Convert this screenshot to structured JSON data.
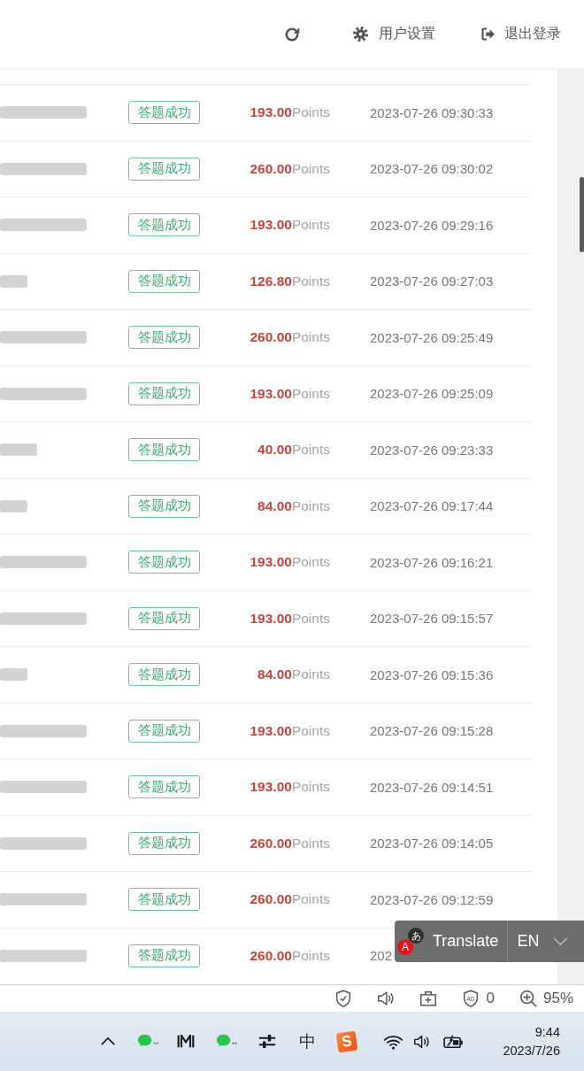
{
  "header": {
    "settings_label": "用户设置",
    "logout_label": "退出登录"
  },
  "rows": [
    {
      "kind": "long",
      "status": "答题成功",
      "amount": "**193.00**Points",
      "time": "2023-07-26 09:30:33"
    },
    {
      "kind": "long",
      "status": "答题成功",
      "amount": "**260.00**Points",
      "time": "2023-07-26 09:30:02"
    },
    {
      "kind": "long",
      "status": "答题成功",
      "amount": "**193.00**Points",
      "time": "2023-07-26 09:29:16"
    },
    {
      "kind": "short",
      "status": "答题成功",
      "amount": "**126.80**Points",
      "time": "2023-07-26 09:27:03"
    },
    {
      "kind": "long",
      "status": "答题成功",
      "amount": "**260.00**Points",
      "time": "2023-07-26 09:25:49"
    },
    {
      "kind": "long",
      "status": "答题成功",
      "amount": "**193.00**Points",
      "time": "2023-07-26 09:25:09"
    },
    {
      "kind": "medium",
      "status": "答题成功",
      "amount": "**40.00**Points",
      "time": "2023-07-26 09:23:33"
    },
    {
      "kind": "short",
      "status": "答题成功",
      "amount": "**84.00**Points",
      "time": "2023-07-26 09:17:44"
    },
    {
      "kind": "long",
      "status": "答题成功",
      "amount": "**193.00**Points",
      "time": "2023-07-26 09:16:21"
    },
    {
      "kind": "long",
      "status": "答题成功",
      "amount": "**193.00**Points",
      "time": "2023-07-26 09:15:57"
    },
    {
      "kind": "short",
      "status": "答题成功",
      "amount": "**84.00**Points",
      "time": "2023-07-26 09:15:36"
    },
    {
      "kind": "long",
      "status": "答题成功",
      "amount": "**193.00**Points",
      "time": "2023-07-26 09:15:28"
    },
    {
      "kind": "long",
      "status": "答题成功",
      "amount": "**193.00**Points",
      "time": "2023-07-26 09:14:51"
    },
    {
      "kind": "long",
      "status": "答题成功",
      "amount": "**260.00**Points",
      "time": "2023-07-26 09:14:05"
    },
    {
      "kind": "long",
      "status": "答题成功",
      "amount": "**260.00**Points",
      "time": "2023-07-26 09:12:59"
    },
    {
      "kind": "long",
      "status": "答题成功",
      "amount": "**260.00**Points",
      "time": "202"
    }
  ],
  "translate_bar": {
    "icon_glyphs": [
      "あ",
      "A"
    ],
    "label": "Translate",
    "language": "EN"
  },
  "status_bar": {
    "ad_badge": "AD",
    "blocked_count": "0",
    "zoom": "95%"
  },
  "taskbar": {
    "ime_mode": "中",
    "ime_logo": "S",
    "time": "9:44",
    "date": "2023/7/26"
  }
}
